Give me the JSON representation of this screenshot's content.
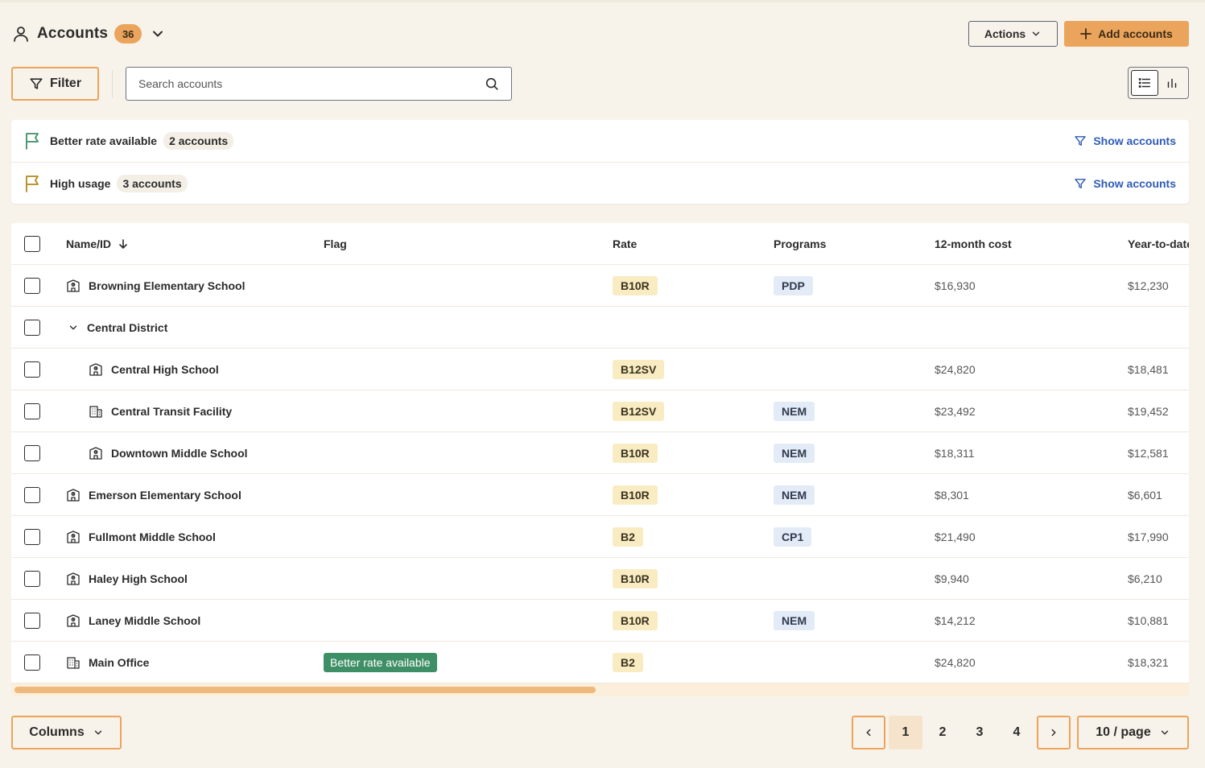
{
  "header": {
    "title": "Accounts",
    "count": "36",
    "actions_label": "Actions",
    "add_label": "Add accounts"
  },
  "toolbar": {
    "filter_label": "Filter",
    "search_placeholder": "Search accounts",
    "search_value": "",
    "view_mode": "list"
  },
  "flags": [
    {
      "label": "Better rate available",
      "count": "2 accounts",
      "action": "Show accounts",
      "color": "#3f8f66"
    },
    {
      "label": "High usage",
      "count": "3 accounts",
      "action": "Show accounts",
      "color": "#b08a1e"
    }
  ],
  "table": {
    "columns": [
      "Name/ID",
      "Flag",
      "Rate",
      "Programs",
      "12-month cost",
      "Year-to-date"
    ],
    "rows": [
      {
        "name": "Browning Elementary School",
        "icon": "school-icon",
        "indent": 0,
        "flag": "",
        "rate": "B10R",
        "program": "PDP",
        "cost12": "$16,930",
        "ytd": "$12,230"
      },
      {
        "name": "Central District",
        "icon": "chevron-down-icon",
        "indent": 0,
        "group": true,
        "flag": "",
        "rate": "",
        "program": "",
        "cost12": "",
        "ytd": ""
      },
      {
        "name": "Central High School",
        "icon": "school-icon",
        "indent": 1,
        "flag": "",
        "rate": "B12SV",
        "program": "",
        "cost12": "$24,820",
        "ytd": "$18,481"
      },
      {
        "name": "Central Transit Facility",
        "icon": "office-building-icon",
        "indent": 1,
        "flag": "",
        "rate": "B12SV",
        "program": "NEM",
        "cost12": "$23,492",
        "ytd": "$19,452"
      },
      {
        "name": "Downtown Middle School",
        "icon": "school-icon",
        "indent": 1,
        "flag": "",
        "rate": "B10R",
        "program": "NEM",
        "cost12": "$18,311",
        "ytd": "$12,581"
      },
      {
        "name": "Emerson Elementary School",
        "icon": "school-icon",
        "indent": 0,
        "flag": "",
        "rate": "B10R",
        "program": "NEM",
        "cost12": "$8,301",
        "ytd": "$6,601"
      },
      {
        "name": "Fullmont Middle School",
        "icon": "school-icon",
        "indent": 0,
        "flag": "",
        "rate": "B2",
        "program": "CP1",
        "cost12": "$21,490",
        "ytd": "$17,990"
      },
      {
        "name": "Haley High School",
        "icon": "school-icon",
        "indent": 0,
        "flag": "",
        "rate": "B10R",
        "program": "",
        "cost12": "$9,940",
        "ytd": "$6,210"
      },
      {
        "name": "Laney Middle School",
        "icon": "school-icon",
        "indent": 0,
        "flag": "",
        "rate": "B10R",
        "program": "NEM",
        "cost12": "$14,212",
        "ytd": "$10,881"
      },
      {
        "name": "Main Office",
        "icon": "office-building-icon",
        "indent": 0,
        "flag": "Better rate available",
        "rate": "B2",
        "program": "",
        "cost12": "$24,820",
        "ytd": "$18,321"
      }
    ]
  },
  "footer": {
    "columns_label": "Columns",
    "pages": [
      "1",
      "2",
      "3",
      "4"
    ],
    "current_page": "1",
    "per_page_label": "10 / page"
  },
  "colors": {
    "accent": "#eba45c",
    "background": "#f8f3ea",
    "link": "#2f5bb5",
    "flag_green": "#3f8f66"
  }
}
